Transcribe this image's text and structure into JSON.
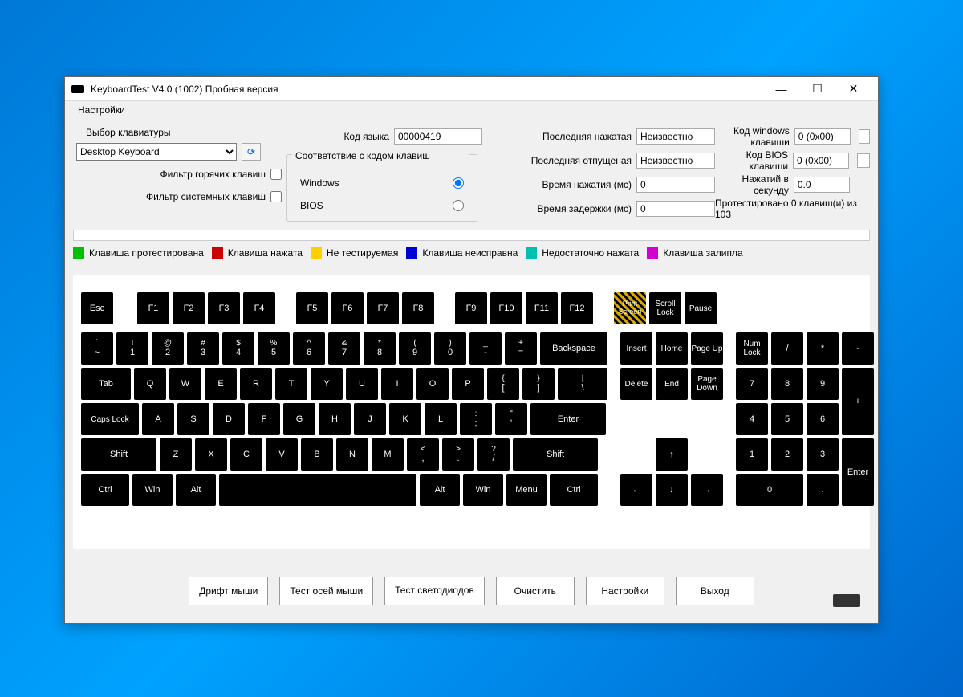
{
  "window": {
    "title": "KeyboardTest V4.0 (1002) Пробная версия"
  },
  "menu": {
    "settings": "Настройки"
  },
  "settings": {
    "kb_select_label": "Выбор клавиатуры",
    "kb_select_value": "Desktop Keyboard",
    "hotkey_filter": "Фильтр горячих клавиш",
    "syskey_filter": "Фильтр системных клавиш",
    "code_match_legend": "Соответствие с кодом клавиш",
    "radio_windows": "Windows",
    "radio_bios": "BIOS",
    "lang_code_label": "Код языка",
    "lang_code_value": "00000419",
    "last_pressed_label": "Последняя нажатая",
    "last_pressed_value": "Неизвестно",
    "last_released_label": "Последняя отпущеная",
    "last_released_value": "Неизвестно",
    "press_time_label": "Время нажатия (мс)",
    "press_time_value": "0",
    "delay_time_label": "Время задержки (мс)",
    "delay_time_value": "0",
    "win_keycode_label": "Код windows клавиши",
    "win_keycode_value": "0 (0x00)",
    "bios_keycode_label": "Код BIOS клавиши",
    "bios_keycode_value": "0 (0x00)",
    "presses_per_sec_label": "Нажатий в секунду",
    "presses_per_sec_value": "0.0",
    "tested_status": "Протестировано 0 клавиш(и) из 103"
  },
  "legend": {
    "tested": "Клавиша протестирована",
    "pressed": "Клавиша нажата",
    "nottestable": "Не тестируемая",
    "faulty": "Клавиша неисправна",
    "insufficient": "Недостаточно нажата",
    "stuck": "Клавиша залипла",
    "colors": {
      "tested": "#00c000",
      "pressed": "#d00000",
      "nottestable": "#ffd000",
      "faulty": "#0000d0",
      "insufficient": "#00c0b0",
      "stuck": "#d000d0"
    }
  },
  "keys": {
    "esc": "Esc",
    "f1": "F1",
    "f2": "F2",
    "f3": "F3",
    "f4": "F4",
    "f5": "F5",
    "f6": "F6",
    "f7": "F7",
    "f8": "F8",
    "f9": "F9",
    "f10": "F10",
    "f11": "F11",
    "f12": "F12",
    "prtsc": "Print Screen",
    "scrlk": "Scroll Lock",
    "pause": "Pause",
    "tilde_top": "`",
    "tilde_bot": "~",
    "n1_top": "!",
    "n1_bot": "1",
    "n2_top": "@",
    "n2_bot": "2",
    "n3_top": "#",
    "n3_bot": "3",
    "n4_top": "$",
    "n4_bot": "4",
    "n5_top": "%",
    "n5_bot": "5",
    "n6_top": "^",
    "n6_bot": "6",
    "n7_top": "&",
    "n7_bot": "7",
    "n8_top": "*",
    "n8_bot": "8",
    "n9_top": "(",
    "n9_bot": "9",
    "n0_top": ")",
    "n0_bot": "0",
    "minus_top": "_",
    "minus_bot": "-",
    "equal_top": "+",
    "equal_bot": "=",
    "backspace": "Backspace",
    "tab": "Tab",
    "q": "Q",
    "w": "W",
    "e": "E",
    "r": "R",
    "t": "T",
    "y": "Y",
    "u": "U",
    "i": "I",
    "o": "O",
    "p": "P",
    "lbr_top": "{",
    "lbr_bot": "[",
    "rbr_top": "}",
    "rbr_bot": "]",
    "bslash_top": "|",
    "bslash_bot": "\\",
    "caps": "Caps Lock",
    "enter": "Enter",
    "a": "A",
    "s": "S",
    "d": "D",
    "f": "F",
    "g": "G",
    "h": "H",
    "j": "J",
    "k": "K",
    "l": "L",
    "semi_top": ":",
    "semi_bot": ";",
    "quote_top": "\"",
    "quote_bot": "'",
    "lshift": "Shift",
    "rshift": "Shift",
    "z": "Z",
    "x": "X",
    "c": "C",
    "v": "V",
    "b": "B",
    "n": "N",
    "m": "M",
    "comma_top": "<",
    "comma_bot": ",",
    "period_top": ">",
    "period_bot": ".",
    "slash_top": "?",
    "slash_bot": "/",
    "lctrl": "Ctrl",
    "lwin": "Win",
    "lalt": "Alt",
    "ralt": "Alt",
    "rwin": "Win",
    "menu": "Menu",
    "rctrl": "Ctrl",
    "insert": "Insert",
    "home": "Home",
    "pgup": "Page Up",
    "delete": "Delete",
    "end": "End",
    "pgdn": "Page Down",
    "up": "↑",
    "down": "↓",
    "left": "←",
    "right": "→",
    "numlock": "Num Lock",
    "numdiv": "/",
    "nummul": "*",
    "numsub": "-",
    "numadd": "+",
    "numenter": "Enter",
    "num7": "7",
    "num8": "8",
    "num9": "9",
    "num4": "4",
    "num5": "5",
    "num6": "6",
    "num1": "1",
    "num2": "2",
    "num3": "3",
    "num0": "0",
    "numdot": "."
  },
  "buttons": {
    "mouse_drift": "Дрифт мыши",
    "mouse_axis": "Тест осей мыши",
    "led_test": "Тест светодиодов",
    "clear": "Очистить",
    "settings": "Настройки",
    "exit": "Выход"
  }
}
